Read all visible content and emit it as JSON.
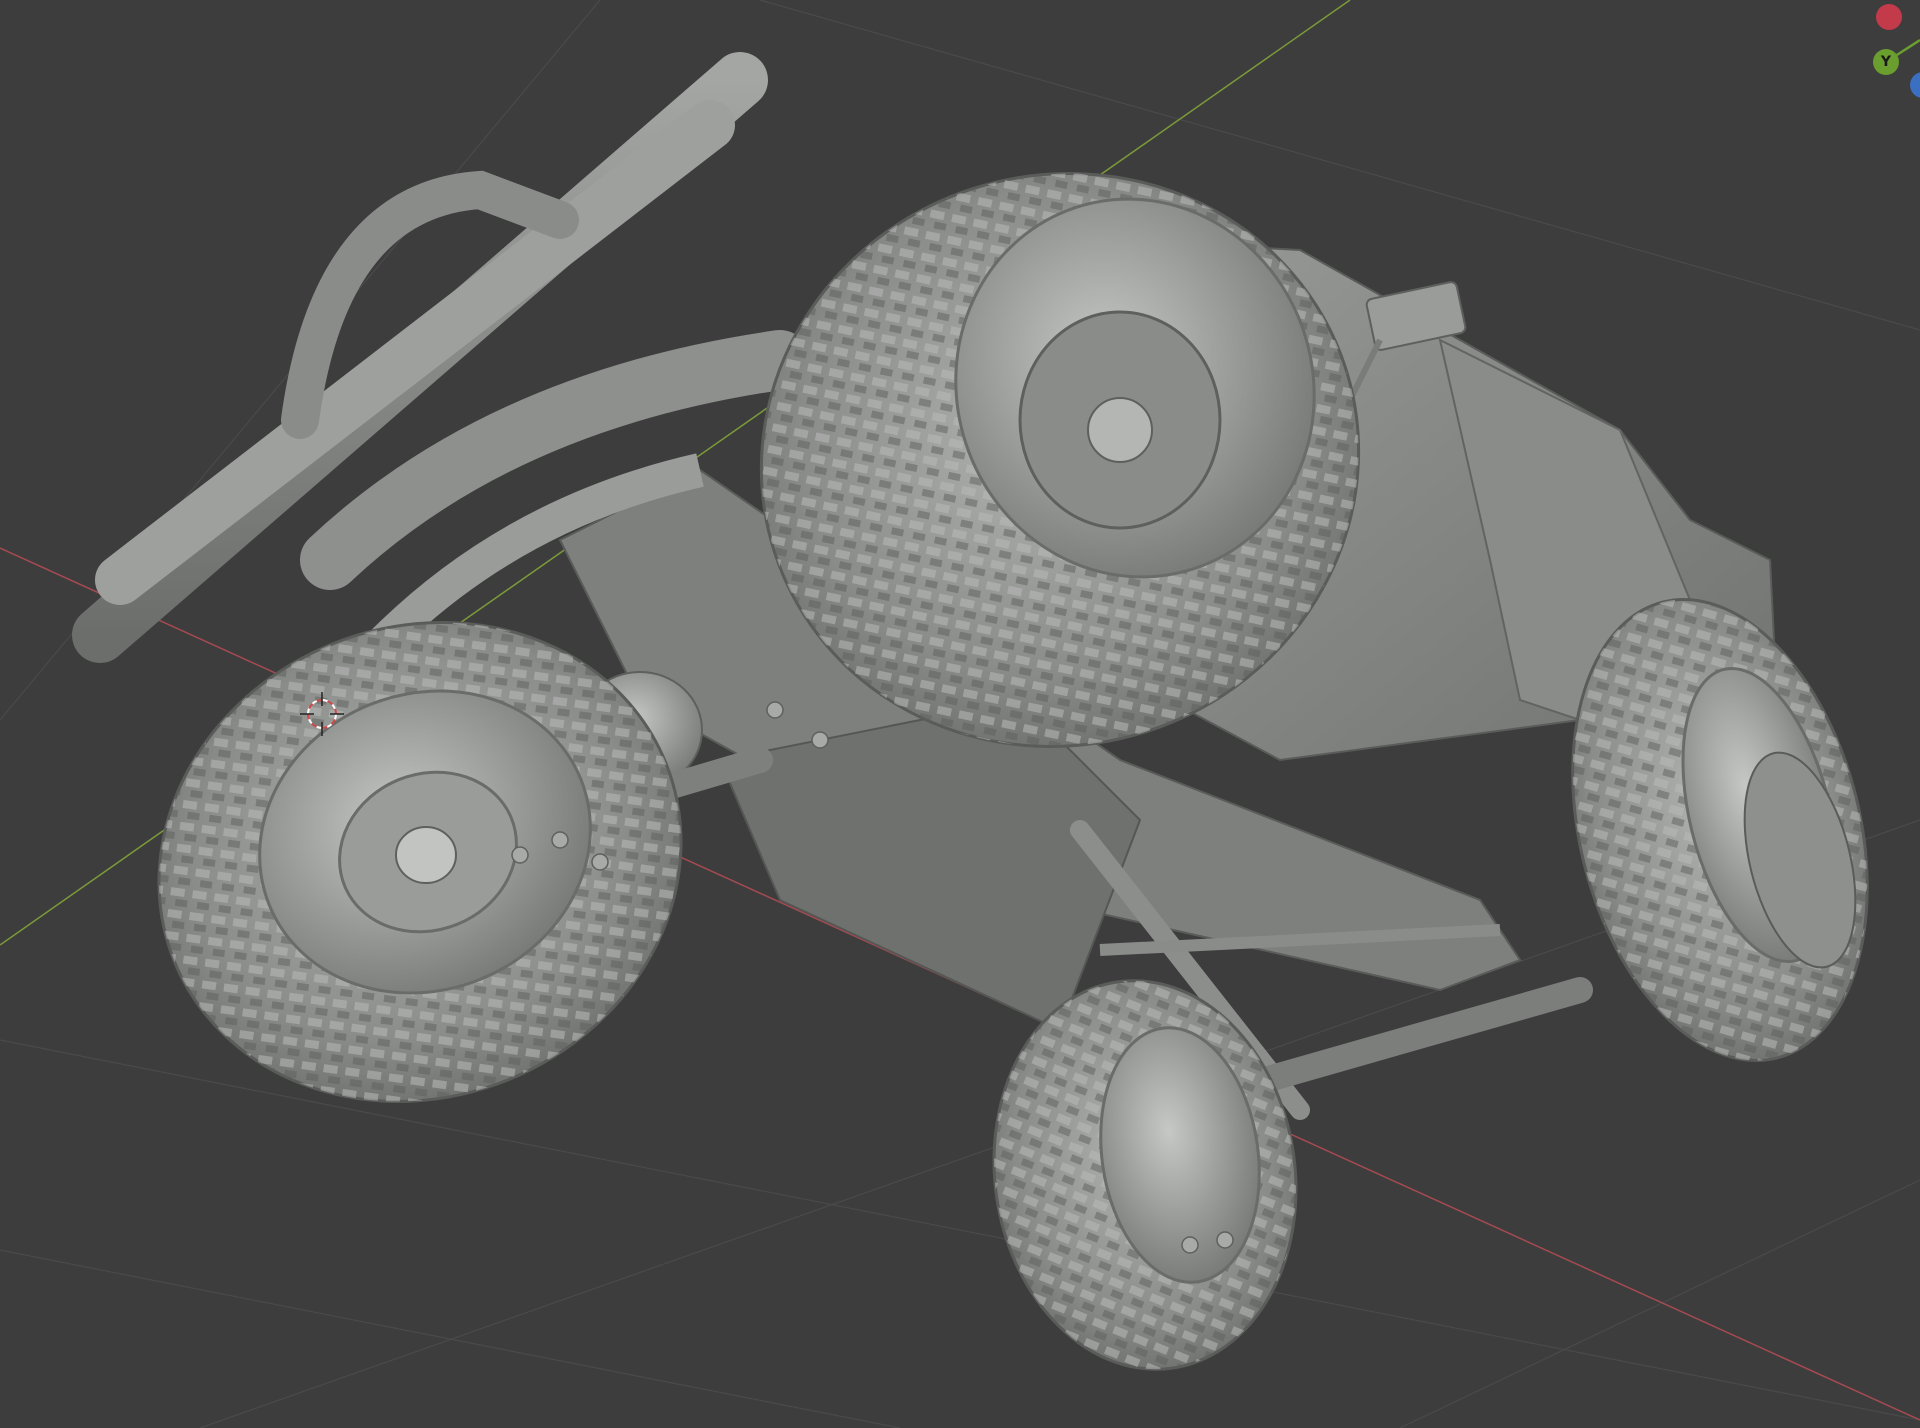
{
  "viewport": {
    "background": "#3d3d3d",
    "model_color": "#8e908e"
  },
  "gizmo": {
    "y_label": "Y",
    "y_color": "#6a9e2e",
    "x_color": "#c33b4a",
    "z_color": "#3b6fc2"
  },
  "axes": {
    "x_axis_color": "#a64a52",
    "y_axis_color": "#7b9a3a"
  },
  "icons": {
    "cursor": "3d-cursor-icon",
    "gizmo": "navigation-gizmo-icon"
  }
}
